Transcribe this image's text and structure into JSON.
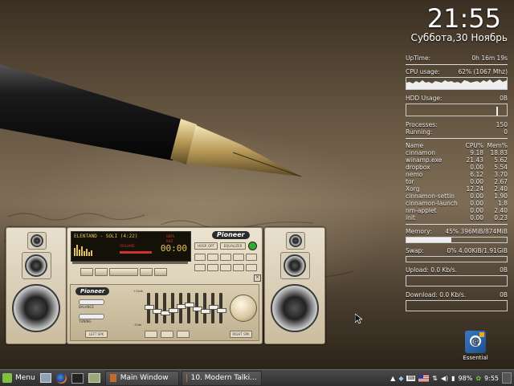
{
  "clock": {
    "time": "21:55",
    "date": "Суббота,30 Ноябрь"
  },
  "conky": {
    "uptime_label": "UpTime:",
    "uptime": "0h 16m 19s",
    "cpu_label": "CPU usage:",
    "cpu_value": "62% (1067 Mhz)",
    "hdd_label": "HDD Usage:",
    "hdd_value": "0B",
    "processes_label": "Processes:",
    "processes": "150",
    "running_label": "Running:",
    "running": "0",
    "proc_headers": [
      "Name",
      "CPU%",
      "Mem%"
    ],
    "procs": [
      [
        "cinnamon",
        "9.18",
        "18.83"
      ],
      [
        "winamp.exe",
        "21.43",
        "5.62"
      ],
      [
        "dropbox",
        "0.00",
        "5.54"
      ],
      [
        "nemo",
        "6.12",
        "3.70"
      ],
      [
        "tor",
        "0.00",
        "2.67"
      ],
      [
        "Xorg",
        "12.24",
        "2.40"
      ],
      [
        "cinnamon-settin",
        "0.00",
        "1.90"
      ],
      [
        "cinnamon-launch",
        "0.00",
        "1.8"
      ],
      [
        "nm-applet",
        "0.00",
        "2.40"
      ],
      [
        "init",
        "0.00",
        "0.23"
      ]
    ],
    "memory_label": "Memory:",
    "memory_value": "45% 396MiB/874MiB",
    "memory_fraction": 0.45,
    "swap_label": "Swap:",
    "swap_value": "0% 4.00KiB/1.91GiB",
    "swap_fraction": 0.0,
    "upload_label": "Upload: 0.0 Kb/s.",
    "upload_total": "0B",
    "download_label": "Download: 0.0 Kb/s.",
    "download_total": "0B"
  },
  "winamp": {
    "track_title": "ELENTAND - SOLI (4:22)",
    "time": "00:00",
    "brand": "Pioneer",
    "vol_label": "VOLUME",
    "buttons": [
      "HOSP. OPT",
      "EQUALIZER",
      "LEFT SPK",
      "RIGHT SPK",
      "BALANCE",
      "TUNING",
      "KBPS",
      "KHZ"
    ],
    "eq_labels": [
      "+12db",
      "-12db"
    ],
    "eq_levels": [
      0.55,
      0.4,
      0.35,
      0.45,
      0.6,
      0.65,
      0.5,
      0.4,
      0.55,
      0.45
    ]
  },
  "desktop_icons": [
    {
      "label": "Essential",
      "icon": "address-book-icon"
    }
  ],
  "taskbar": {
    "menu_label": "Menu",
    "windows": [
      "Main Window",
      "10. Modern Talki..."
    ],
    "battery": "98%",
    "time": "9:55"
  },
  "colors": {
    "taskbar": "#3c3c3c",
    "mint_green": "#7fc241",
    "winamp_display_text": "#e5c15b"
  }
}
